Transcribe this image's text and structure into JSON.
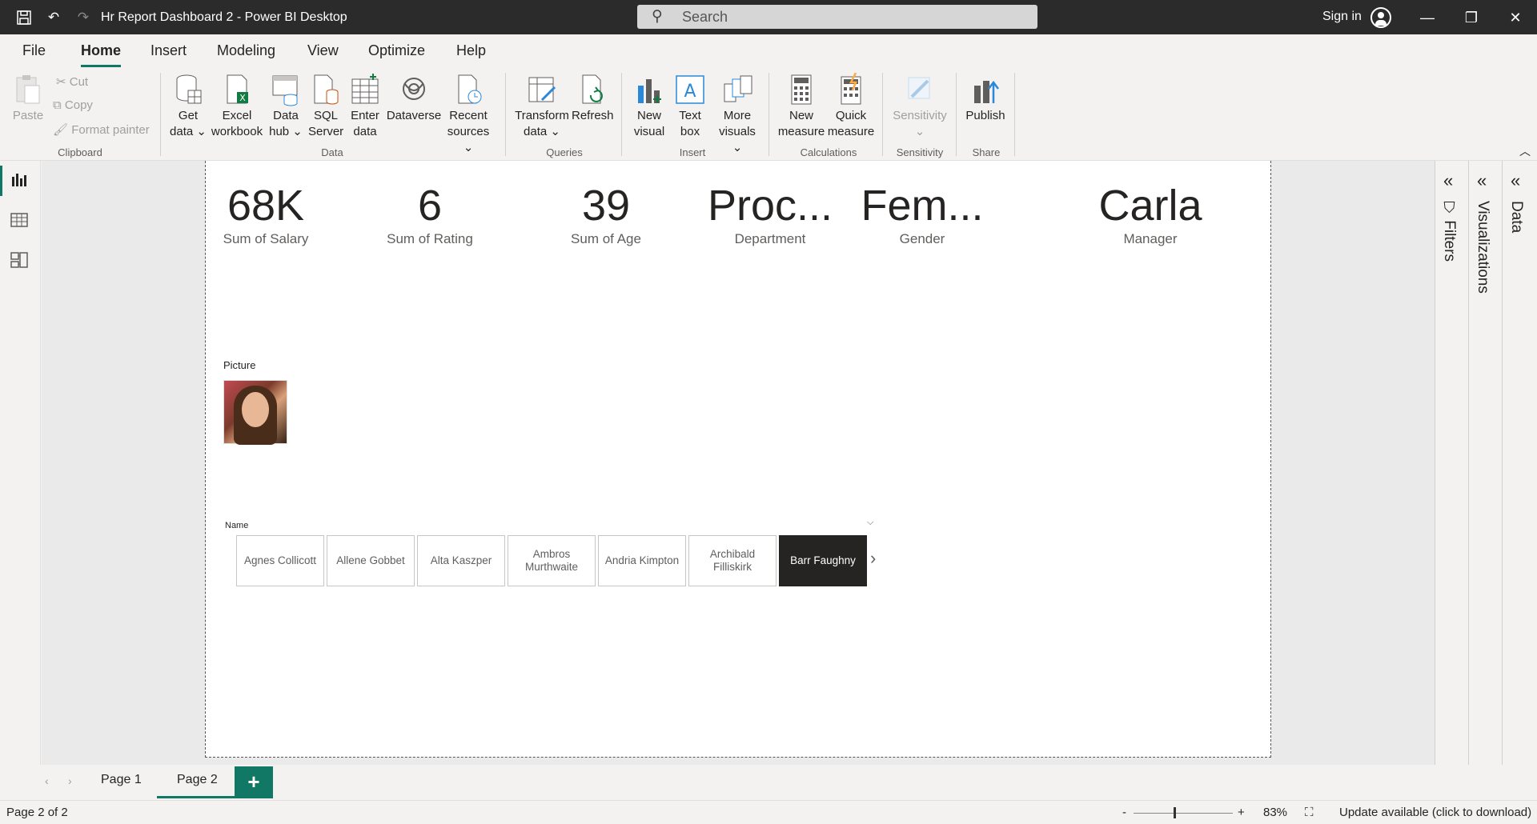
{
  "titlebar": {
    "app_title": "Hr Report Dashboard 2 - Power BI Desktop",
    "search_placeholder": "Search",
    "sign_in": "Sign in"
  },
  "menu": {
    "tabs": [
      {
        "label": "File"
      },
      {
        "label": "Home"
      },
      {
        "label": "Insert"
      },
      {
        "label": "Modeling"
      },
      {
        "label": "View"
      },
      {
        "label": "Optimize"
      },
      {
        "label": "Help"
      }
    ],
    "active": "Home"
  },
  "ribbon": {
    "clipboard": {
      "paste": "Paste",
      "cut": "Cut",
      "copy": "Copy",
      "format_painter": "Format painter",
      "label": "Clipboard"
    },
    "data": {
      "get_data": [
        "Get",
        "data ⌄"
      ],
      "excel": [
        "Excel",
        "workbook"
      ],
      "data_hub": [
        "Data",
        "hub ⌄"
      ],
      "sql": [
        "SQL",
        "Server"
      ],
      "enter": [
        "Enter",
        "data"
      ],
      "dataverse": "Dataverse",
      "recent": [
        "Recent",
        "sources ⌄"
      ],
      "label": "Data"
    },
    "queries": {
      "transform": [
        "Transform",
        "data ⌄"
      ],
      "refresh": "Refresh",
      "label": "Queries"
    },
    "insert": {
      "new_visual": [
        "New",
        "visual"
      ],
      "text_box": [
        "Text",
        "box"
      ],
      "more_visuals": [
        "More",
        "visuals ⌄"
      ],
      "label": "Insert"
    },
    "calculations": {
      "new_measure": [
        "New",
        "measure"
      ],
      "quick_measure": [
        "Quick",
        "measure"
      ],
      "label": "Calculations"
    },
    "sensitivity": {
      "btn": [
        "Sensitivity",
        "⌄"
      ],
      "label": "Sensitivity"
    },
    "share": {
      "publish": "Publish",
      "label": "Share"
    }
  },
  "cards": [
    {
      "value": "68K",
      "label": "Sum of Salary"
    },
    {
      "value": "6",
      "label": "Sum of Rating"
    },
    {
      "value": "39",
      "label": "Sum of Age"
    },
    {
      "value": "Proc...",
      "label": "Department"
    },
    {
      "value": "Fem...",
      "label": "Gender"
    },
    {
      "value": "Carla",
      "label": "Manager"
    }
  ],
  "picture": {
    "title": "Picture"
  },
  "slicer": {
    "title": "Name",
    "items": [
      {
        "label": "Agnes Collicott",
        "selected": false
      },
      {
        "label": "Allene Gobbet",
        "selected": false
      },
      {
        "label": "Alta Kaszper",
        "selected": false
      },
      {
        "label": "Ambros Murthwaite",
        "selected": false
      },
      {
        "label": "Andria Kimpton",
        "selected": false
      },
      {
        "label": "Archibald Filliskirk",
        "selected": false
      },
      {
        "label": "Barr Faughny",
        "selected": true
      }
    ]
  },
  "panes": {
    "filters": "Filters",
    "visualizations": "Visualizations",
    "data": "Data"
  },
  "pages": {
    "tabs": [
      "Page 1",
      "Page 2"
    ],
    "active": "Page 2",
    "add": "+"
  },
  "status": {
    "page_info": "Page 2 of 2",
    "zoom": "83%",
    "update": "Update available (click to download)"
  },
  "colors": {
    "accent": "#117865",
    "titlebar": "#2b2b2b"
  }
}
